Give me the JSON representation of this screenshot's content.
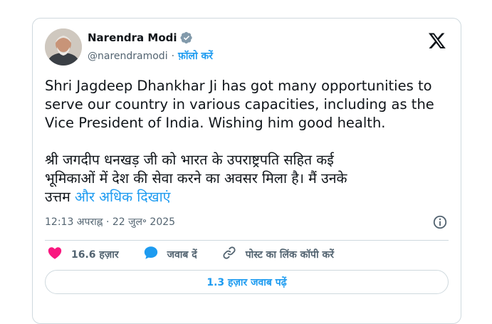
{
  "author": {
    "name": "Narendra Modi",
    "handle": "@narendramodi",
    "separator": "·",
    "follow_label": "फ़ॉलो करें"
  },
  "tweet": {
    "text_en": "Shri Jagdeep Dhankhar Ji has got many opportunities to\nserve our country in various capacities, including as the\nVice President of India. Wishing him good health.",
    "text_hi": "श्री जगदीप धनखड़ जी को भारत के उपराष्ट्रपति सहित कई\nभूमिकाओं में देश की सेवा करने का अवसर मिला है। मैं उनके\nउत्तम ",
    "show_more_label": "और अधिक दिखाएं",
    "timestamp": "12:13 अपराह्न · 22 जुल॰ 2025"
  },
  "actions": {
    "like_count": "16.6 हज़ार",
    "reply_label": "जवाब दें",
    "copy_link_label": "पोस्ट का लिंक कॉपी करें"
  },
  "read_replies_label": "1.3 हज़ार जवाब पढ़ें",
  "icons": {
    "verified": "verified-badge-icon",
    "platform": "x-logo-icon",
    "info": "info-icon",
    "like": "heart-icon",
    "reply": "speech-bubble-icon",
    "copy": "link-icon"
  },
  "colors": {
    "accent": "#1d9bf0",
    "like": "#f91880",
    "text": "#0f1419",
    "muted": "#536471",
    "border": "#cfd9de"
  }
}
